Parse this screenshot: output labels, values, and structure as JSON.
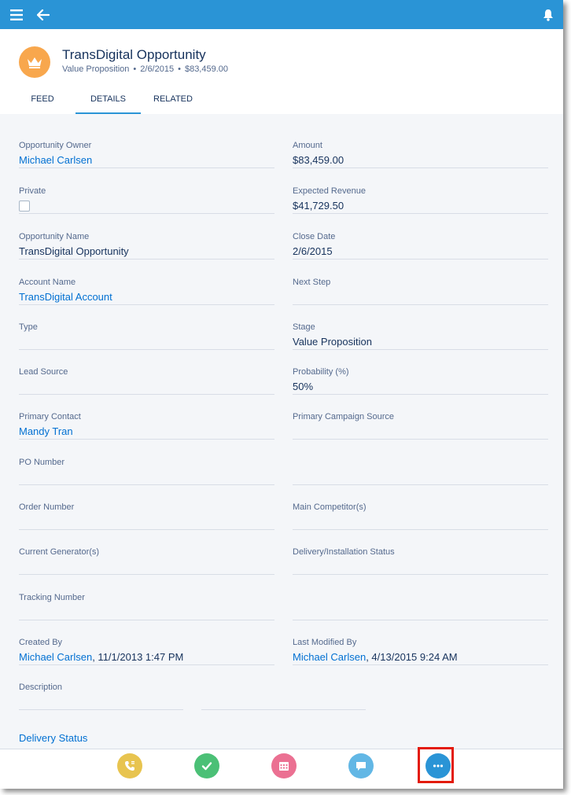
{
  "topbar": {
    "icons": [
      "hamburger-menu-icon",
      "back-arrow-icon",
      "notification-bell-icon"
    ],
    "color": "#2a94d6"
  },
  "record": {
    "icon": "crown-icon",
    "title": "TransDigital Opportunity",
    "stage": "Value Proposition",
    "close_date": "2/6/2015",
    "amount": "$83,459.00"
  },
  "tabs": [
    {
      "label": "FEED"
    },
    {
      "label": "DETAILS"
    },
    {
      "label": "RELATED"
    }
  ],
  "fields": {
    "opportunity_owner": {
      "label": "Opportunity Owner",
      "value": "Michael Carlsen"
    },
    "amount": {
      "label": "Amount",
      "value": "$83,459.00"
    },
    "private": {
      "label": "Private"
    },
    "expected_revenue": {
      "label": "Expected Revenue",
      "value": "$41,729.50"
    },
    "opportunity_name": {
      "label": "Opportunity Name",
      "value": "TransDigital Opportunity"
    },
    "close_date": {
      "label": "Close Date",
      "value": "2/6/2015"
    },
    "account_name": {
      "label": "Account Name",
      "value": "TransDigital Account"
    },
    "next_step": {
      "label": "Next Step"
    },
    "type": {
      "label": "Type"
    },
    "stage": {
      "label": "Stage",
      "value": "Value Proposition"
    },
    "lead_source": {
      "label": "Lead Source"
    },
    "probability": {
      "label": "Probability (%)",
      "value": "50%"
    },
    "primary_contact": {
      "label": "Primary Contact",
      "value": "Mandy Tran"
    },
    "primary_campaign_source": {
      "label": "Primary Campaign Source"
    },
    "po_number": {
      "label": "PO Number"
    },
    "order_number": {
      "label": "Order Number"
    },
    "main_competitors": {
      "label": "Main Competitor(s)"
    },
    "current_generators": {
      "label": "Current Generator(s)"
    },
    "delivery_installation_status": {
      "label": "Delivery/Installation Status"
    },
    "tracking_number": {
      "label": "Tracking Number"
    },
    "created_by": {
      "label": "Created By",
      "user": "Michael Carlsen",
      "date": ", 11/1/2013 1:47 PM"
    },
    "last_modified_by": {
      "label": "Last Modified By",
      "user": "Michael Carlsen",
      "date": ", 4/13/2015 9:24 AM"
    },
    "description": {
      "label": "Description"
    }
  },
  "section": {
    "delivery_status": "Delivery Status"
  },
  "actions": [
    {
      "icon": "log-call-icon",
      "color": "#e8c44f"
    },
    {
      "icon": "new-task-icon",
      "color": "#4bc076"
    },
    {
      "icon": "new-event-icon",
      "color": "#eb7092"
    },
    {
      "icon": "post-icon",
      "color": "#62b7e5"
    },
    {
      "icon": "more-actions-icon",
      "color": "#2a94d6"
    }
  ],
  "highlight_color": "#e31b0c"
}
